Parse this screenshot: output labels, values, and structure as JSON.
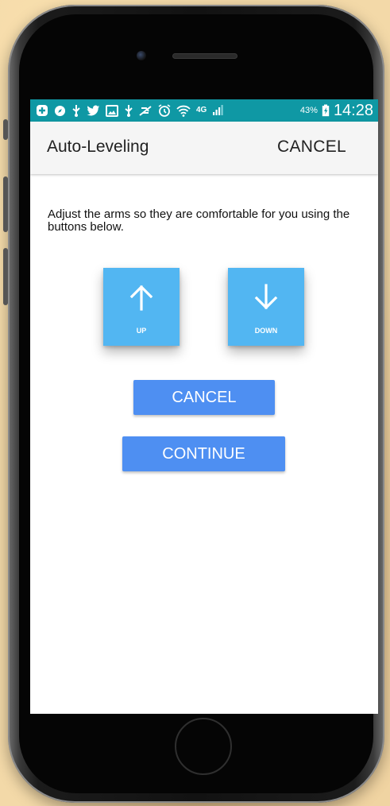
{
  "status_bar": {
    "icons": [
      "shield-plus-icon",
      "compass-icon",
      "usb-icon",
      "twitter-icon",
      "image-icon",
      "usb-icon",
      "mute-icon",
      "alarm-icon",
      "wifi-icon",
      "4g-icon",
      "signal-icon"
    ],
    "network_label": "4G",
    "battery_percent": "43%",
    "time": "14:28"
  },
  "app_bar": {
    "title": "Auto-Leveling",
    "cancel_label": "CANCEL"
  },
  "main": {
    "instructions": "Adjust the arms so they are comfortable for you using the buttons below.",
    "up_label": "UP",
    "down_label": "DOWN",
    "cancel_label": "CANCEL",
    "continue_label": "CONTINUE"
  },
  "colors": {
    "status_bar": "#0f98a4",
    "direction_buttons": "#52b6f2",
    "action_buttons": "#4e8ff2",
    "app_bar": "#f5f5f5"
  }
}
